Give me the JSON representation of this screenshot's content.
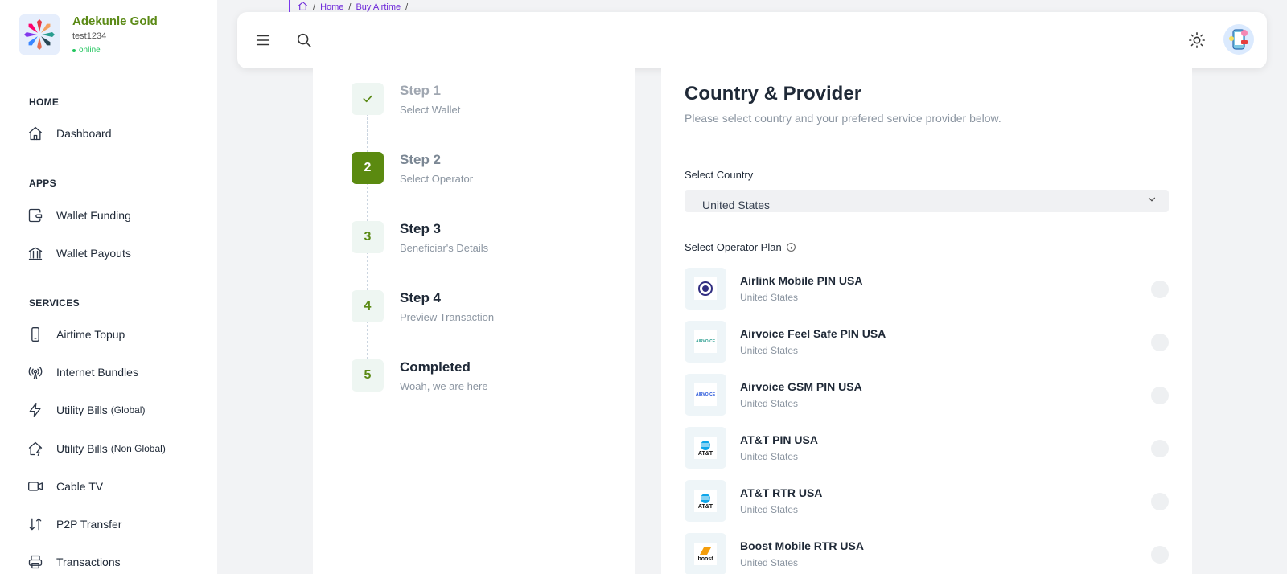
{
  "profile": {
    "name": "Adekunle Gold",
    "username": "test1234",
    "status": "online"
  },
  "nav": {
    "sections": {
      "home": "HOME",
      "apps": "APPS",
      "services": "SERVICES"
    },
    "items": [
      {
        "label": "Dashboard",
        "icon": "home-icon"
      },
      {
        "label": "Wallet Funding",
        "icon": "wallet-icon"
      },
      {
        "label": "Wallet Payouts",
        "icon": "bank-icon"
      },
      {
        "label": "Airtime Topup",
        "icon": "phone-icon"
      },
      {
        "label": "Internet Bundles",
        "icon": "antenna-icon"
      },
      {
        "label": "Utility Bills",
        "suffix": "(Global)",
        "icon": "bolt-icon"
      },
      {
        "label": "Utility Bills",
        "suffix": "(Non Global)",
        "icon": "house-bolt-icon"
      },
      {
        "label": "Cable TV",
        "icon": "video-icon"
      },
      {
        "label": "P2P Transfer",
        "icon": "transfer-icon"
      },
      {
        "label": "Transactions",
        "icon": "printer-icon"
      }
    ]
  },
  "breadcrumb": {
    "items": [
      "Home",
      "Buy Airtime"
    ],
    "separator": "/"
  },
  "steps": [
    {
      "number": "",
      "title": "Step 1",
      "subtitle": "Select Wallet",
      "state": "done"
    },
    {
      "number": "2",
      "title": "Step 2",
      "subtitle": "Select Operator",
      "state": "current"
    },
    {
      "number": "3",
      "title": "Step 3",
      "subtitle": "Beneficiar's Details",
      "state": "pending"
    },
    {
      "number": "4",
      "title": "Step 4",
      "subtitle": "Preview Transaction",
      "state": "pending"
    },
    {
      "number": "5",
      "title": "Completed",
      "subtitle": "Woah, we are here",
      "state": "pending"
    }
  ],
  "main": {
    "title": "Country & Provider",
    "subtitle": "Please select country and your prefered service provider below.",
    "country_label": "Select Country",
    "country_value": "United States",
    "operator_label": "Select Operator Plan",
    "operators": [
      {
        "name": "Airlink Mobile PIN USA",
        "country": "United States",
        "logo": "AIRLINK"
      },
      {
        "name": "Airvoice Feel Safe PIN USA",
        "country": "United States",
        "logo": "AIRVOICE"
      },
      {
        "name": "Airvoice GSM PIN USA",
        "country": "United States",
        "logo": "AIRVOICE"
      },
      {
        "name": "AT&T PIN USA",
        "country": "United States",
        "logo": "AT&T"
      },
      {
        "name": "AT&T RTR USA",
        "country": "United States",
        "logo": "AT&T"
      },
      {
        "name": "Boost Mobile RTR USA",
        "country": "United States",
        "logo": "boost"
      }
    ]
  },
  "colors": {
    "brand_green": "#5b8a10",
    "accent_purple": "#6d28d9",
    "muted": "#8b95a1"
  }
}
